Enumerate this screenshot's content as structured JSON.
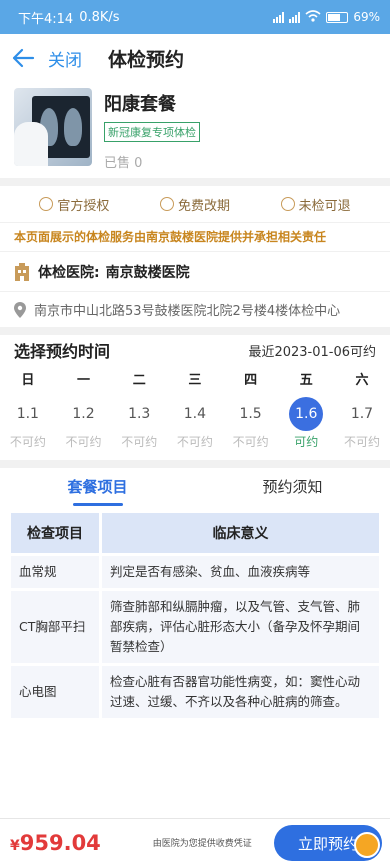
{
  "status": {
    "time": "下午4:14",
    "speed": "0.8K/s",
    "battery": "69%"
  },
  "nav": {
    "close_label": "关闭",
    "title": "体检预约"
  },
  "package": {
    "name": "阳康套餐",
    "tag": "新冠康复专项体检",
    "sold": "已售 0"
  },
  "guarantees": [
    "官方授权",
    "免费改期",
    "未检可退"
  ],
  "notice": "本页面展示的体检服务由南京鼓楼医院提供并承担相关责任",
  "hospital": {
    "label": "体检医院:",
    "name": "南京鼓楼医院"
  },
  "address": "南京市中山北路53号鼓楼医院北院2号楼4楼体检中心",
  "schedule": {
    "title": "选择预约时间",
    "latest": "最近2023-01-06可约",
    "weekdays": [
      "日",
      "一",
      "二",
      "三",
      "四",
      "五",
      "六"
    ],
    "days": [
      {
        "num": "1.1",
        "status": "不可约"
      },
      {
        "num": "1.2",
        "status": "不可约"
      },
      {
        "num": "1.3",
        "status": "不可约"
      },
      {
        "num": "1.4",
        "status": "不可约"
      },
      {
        "num": "1.5",
        "status": "不可约"
      },
      {
        "num": "1.6",
        "status": "可约"
      },
      {
        "num": "1.7",
        "status": "不可约"
      }
    ]
  },
  "tabs": [
    "套餐项目",
    "预约须知"
  ],
  "table": {
    "headers": [
      "检查项目",
      "临床意义"
    ],
    "rows": [
      {
        "item": "血常规",
        "meaning": "判定是否有感染、贫血、血液疾病等"
      },
      {
        "item": "CT胸部平扫",
        "meaning": "筛查肺部和纵膈肿瘤，以及气管、支气管、肺部疾病，评估心脏形态大小（备孕及怀孕期间暂禁检查）"
      },
      {
        "item": "心电图",
        "meaning": "检查心脏有否器官功能性病变，如：窦性心动过速、过缓、不齐以及各种心脏病的筛查。"
      }
    ]
  },
  "bottom": {
    "price_symbol": "¥",
    "price": "959.04",
    "voucher": "由医院为您提供收费凭证",
    "book_label": "立即预约"
  }
}
